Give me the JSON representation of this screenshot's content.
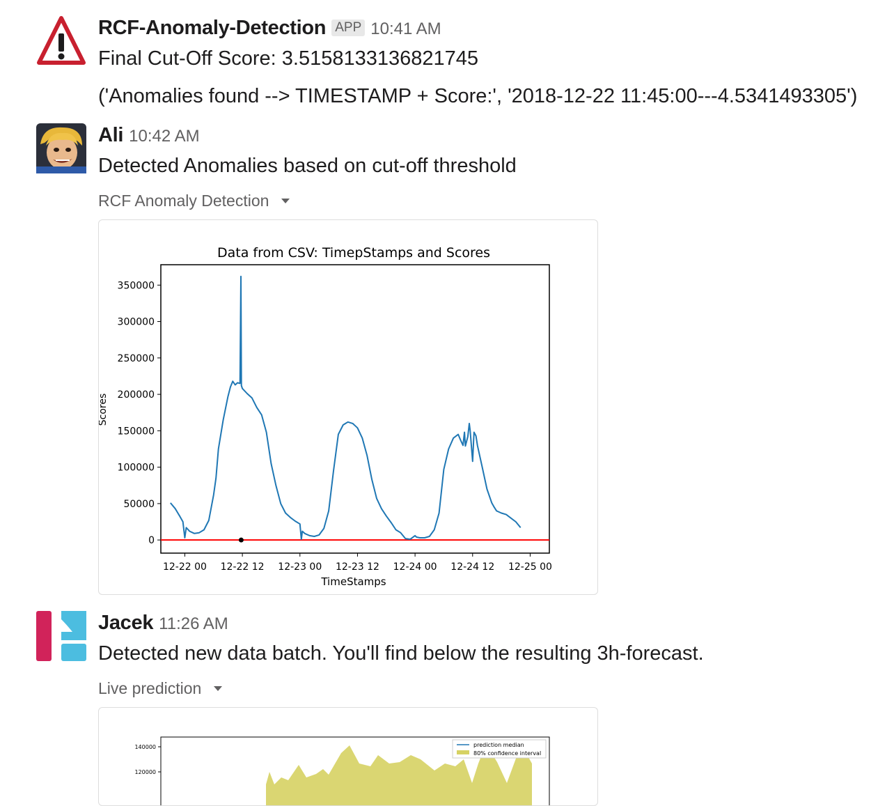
{
  "messages": [
    {
      "sender": "RCF-Anomaly-Detection",
      "badge": "APP",
      "time": "10:41 AM",
      "lines": [
        "Final Cut-Off Score: 3.5158133136821745",
        "('Anomalies found --> TIMESTAMP + Score:', '2018-12-22 11:45:00---4.5341493305')"
      ]
    },
    {
      "sender": "Ali",
      "time": "10:42 AM",
      "text": "Detected Anomalies based on cut-off threshold",
      "file_label": "RCF Anomaly Detection"
    },
    {
      "sender": "Jacek",
      "time": "11:26 AM",
      "text": "Detected new data batch. You'll find below the resulting 3h-forecast.",
      "file_label": "Live prediction"
    }
  ],
  "chart_data": [
    {
      "type": "line",
      "title": "Data from CSV: TimepStamps and Scores",
      "xlabel": "TimeStamps",
      "ylabel": "Scores",
      "x_ticks": [
        "12-22 00",
        "12-22 12",
        "12-23 00",
        "12-23 12",
        "12-24 00",
        "12-24 12",
        "12-25 00"
      ],
      "y_ticks": [
        "0",
        "50000",
        "100000",
        "150000",
        "200000",
        "250000",
        "300000",
        "350000"
      ],
      "xlim_hours": [
        -5,
        76
      ],
      "ylim": [
        -18000,
        378000
      ],
      "threshold": 0,
      "threshold_color": "#ff0000",
      "line_color": "#1f77b4",
      "anomaly_point": {
        "x": "12-22 11:45",
        "hours": 11.75,
        "y": 0
      },
      "series": [
        {
          "hours": [
            -3,
            -2,
            -1,
            -0.4,
            0,
            0.3,
            1,
            2,
            3,
            4,
            5,
            6,
            6.5,
            7,
            8,
            9,
            9.5,
            10,
            10.5,
            11,
            11.5,
            11.7,
            11.8,
            12,
            13,
            14,
            15,
            16,
            17,
            18,
            19,
            20,
            21,
            22,
            23,
            24,
            24.3,
            24.5,
            25,
            26,
            27,
            28,
            29,
            30,
            31,
            32,
            33,
            33.5,
            34,
            35,
            36,
            37,
            38,
            39,
            40,
            41,
            42,
            43,
            44,
            45,
            46,
            47,
            48,
            48.3,
            49,
            50,
            51,
            52,
            53,
            54,
            55,
            56,
            57,
            57.5,
            58,
            58.3,
            58.5,
            59,
            59.3,
            59.5,
            60,
            60.3,
            60.7,
            61,
            62,
            63,
            64,
            64.5,
            65,
            66,
            67,
            68,
            69,
            70,
            71,
            72
          ],
          "values": [
            51000,
            43000,
            32000,
            25000,
            3000,
            17000,
            12000,
            9000,
            10000,
            14000,
            27000,
            62000,
            85000,
            125000,
            165000,
            197000,
            210000,
            218000,
            213000,
            216000,
            215000,
            362000,
            212000,
            208000,
            201000,
            195000,
            182000,
            172000,
            148000,
            105000,
            75000,
            50000,
            37000,
            31000,
            26000,
            22000,
            1000,
            12000,
            9000,
            6000,
            5000,
            7000,
            16000,
            40000,
            95000,
            145000,
            158000,
            160000,
            162000,
            160000,
            154000,
            140000,
            116000,
            83000,
            57000,
            43000,
            33000,
            24000,
            14000,
            10000,
            2000,
            1000,
            6000,
            4000,
            3000,
            3000,
            5000,
            14000,
            37000,
            97000,
            125000,
            140000,
            145000,
            137000,
            130000,
            148000,
            129000,
            142000,
            160000,
            150000,
            108000,
            148000,
            143000,
            130000,
            100000,
            70000,
            51000,
            45000,
            40000,
            37000,
            35000,
            30000,
            25000,
            17000
          ]
        }
      ]
    },
    {
      "type": "area",
      "legend": [
        "prediction median",
        "80% confidence interval"
      ],
      "legend_position": "upper-right",
      "y_ticks": [
        "140000",
        "120000"
      ],
      "band_color": "#d6d263",
      "median_color": "#1f77b4"
    }
  ]
}
